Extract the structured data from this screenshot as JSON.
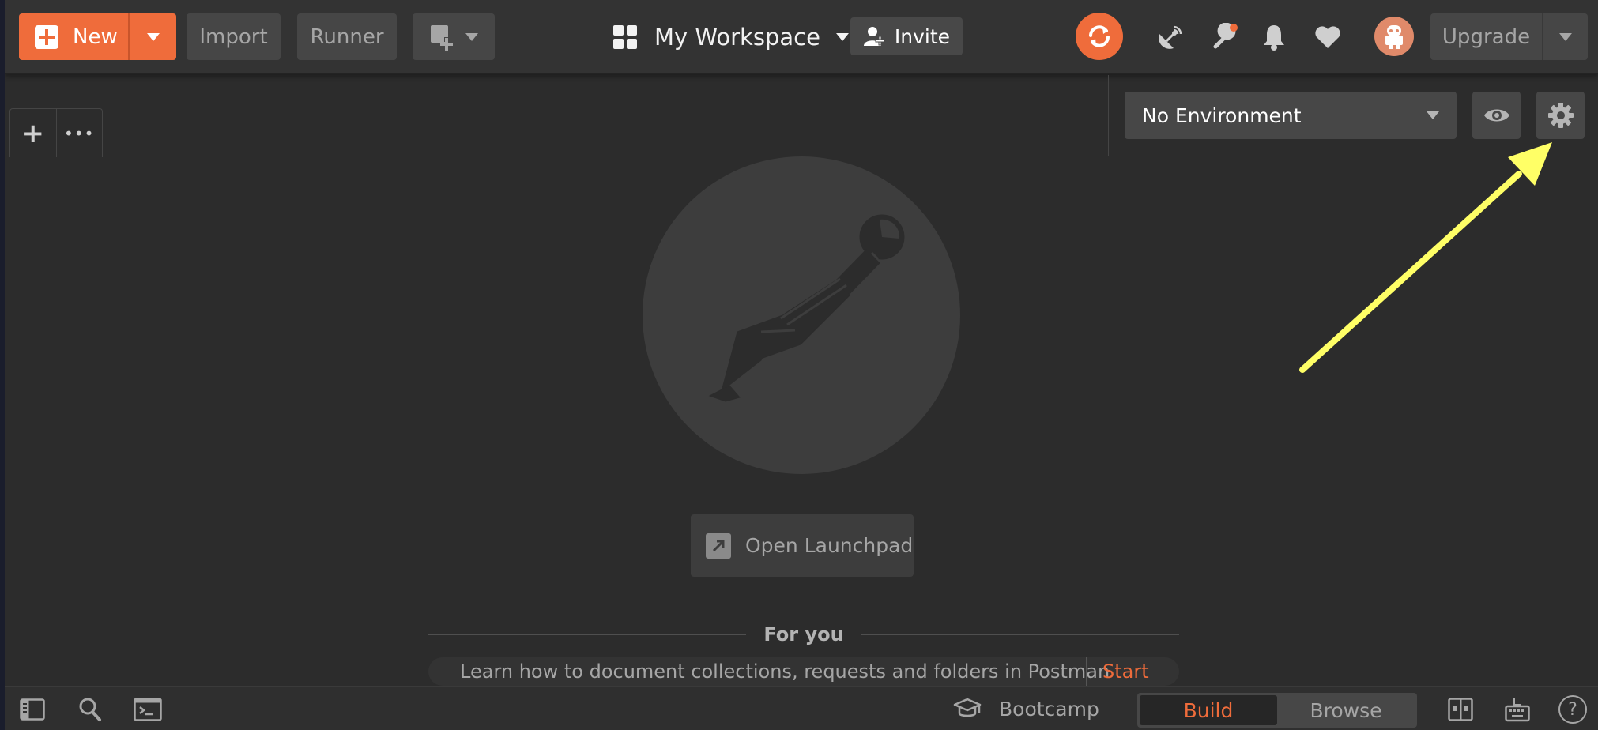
{
  "header": {
    "new_label": "New",
    "import_label": "Import",
    "runner_label": "Runner",
    "workspace_label": "My Workspace",
    "invite_label": "Invite",
    "upgrade_label": "Upgrade"
  },
  "tabs": {
    "add_tab_glyph": "+",
    "more_glyph": "•••"
  },
  "environment": {
    "selected": "No Environment"
  },
  "main": {
    "launchpad_label": "Open Launchpad",
    "for_you_label": "For you",
    "tip_text": "Learn how to document collections, requests and folders in Postman",
    "tip_action": "Start"
  },
  "statusbar": {
    "bootcamp_label": "Bootcamp",
    "build_label": "Build",
    "browse_label": "Browse",
    "help_glyph": "?"
  },
  "colors": {
    "accent": "#ef6c3b",
    "background": "#2c2c2c",
    "header": "#333333",
    "annotation_arrow": "#ffff66"
  },
  "icons": [
    "plus-icon",
    "chevron-down-icon",
    "new-window-icon",
    "grid-icon",
    "add-user-icon",
    "sync-icon",
    "satellite-icon",
    "wrench-icon",
    "bell-icon",
    "heart-icon",
    "avatar-icon",
    "eye-icon",
    "gear-icon",
    "postman-logo",
    "external-link-icon",
    "sidebar-toggle-icon",
    "search-icon",
    "console-icon",
    "graduation-cap-icon",
    "two-pane-icon",
    "keyboard-icon",
    "help-icon"
  ]
}
